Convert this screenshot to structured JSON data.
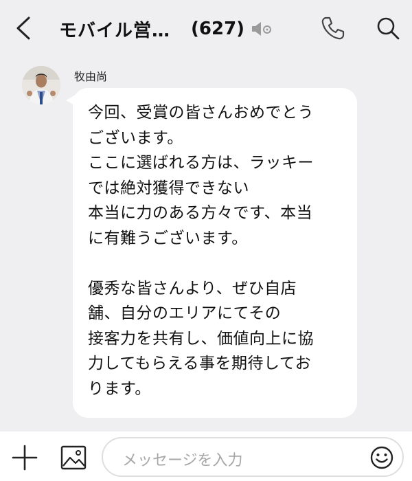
{
  "header": {
    "title": "モバイル営…",
    "member_count": "(627)",
    "icons": {
      "back": "chevron-left-icon",
      "mute": "speaker-muted-icon",
      "call": "phone-icon",
      "search": "search-icon"
    }
  },
  "message": {
    "sender": "牧由尚",
    "avatar": "avatar-photo",
    "lines": [
      "今回、受賞の皆さんおめでとう",
      "ございます。",
      "ここに選ばれる方は、ラッキー",
      "では絶対獲得できない",
      "本当に力のある方々です、本当",
      "に有難うございます。",
      "",
      "優秀な皆さんより、ぜひ自店",
      "舗、自分のエリアにてその",
      "接客力を共有し、価値向上に協",
      "力してもらえる事を期待してお",
      "ります。"
    ]
  },
  "composer": {
    "placeholder": "メッセージを入力",
    "icons": {
      "add": "plus-icon",
      "image": "image-icon",
      "emoji": "smiley-icon"
    }
  }
}
